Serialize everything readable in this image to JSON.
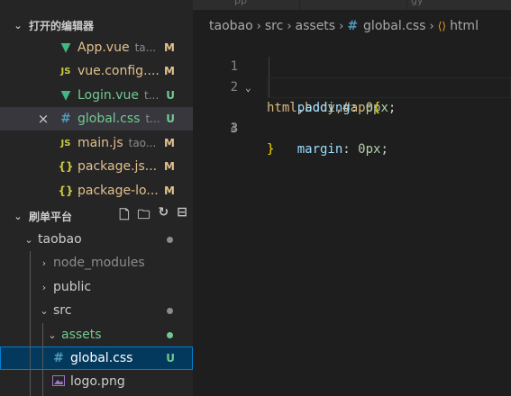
{
  "open_editors": {
    "title": "打开的编辑器",
    "items": [
      {
        "name": "App.vue",
        "desc": "ta...",
        "status": "M",
        "icon": "V",
        "selected": false
      },
      {
        "name": "vue.config....",
        "desc": "",
        "status": "M",
        "icon": "JS",
        "selected": false
      },
      {
        "name": "Login.vue",
        "desc": "t...",
        "status": "U",
        "icon": "V",
        "selected": false
      },
      {
        "name": "global.css",
        "desc": "t...",
        "status": "U",
        "icon": "#",
        "selected": true,
        "close": "×"
      },
      {
        "name": "main.js",
        "desc": "tao...",
        "status": "M",
        "icon": "JS",
        "selected": false
      },
      {
        "name": "package.js...",
        "desc": "",
        "status": "M",
        "icon": "{}",
        "selected": false
      },
      {
        "name": "package-lo...",
        "desc": "",
        "status": "M",
        "icon": "{}",
        "selected": false
      }
    ]
  },
  "explorer": {
    "title": "刷单平台",
    "tree": [
      {
        "name": "taobao",
        "chevron": "⌄",
        "dot": true
      },
      {
        "name": "node_modules",
        "chevron": "›",
        "dot": false
      },
      {
        "name": "public",
        "chevron": "›",
        "dot": false
      },
      {
        "name": "src",
        "chevron": "⌄",
        "dot": true
      },
      {
        "name": "assets",
        "chevron": "⌄",
        "dot": true
      },
      {
        "name": "global.css",
        "icon": "#",
        "status": "U"
      },
      {
        "name": "logo.png",
        "icon": "img"
      }
    ]
  },
  "tabs_fragments": [
    "pp",
    "gy"
  ],
  "breadcrumb": {
    "parts": [
      "taobao",
      "src",
      "assets",
      "global.css",
      "html"
    ],
    "css_icon": "#",
    "symbol_icon": "⟨⟩"
  },
  "code": {
    "lines": [
      {
        "num": "1",
        "fold": "⌄"
      },
      {
        "num": "2"
      },
      {
        "num": "3"
      },
      {
        "num": "4"
      }
    ],
    "tokens": {
      "selector": "html,body,#app",
      "open_brace": "{",
      "prop1": "padding",
      "val1": "0px",
      "prop2": "margin",
      "val2": "0px",
      "colon": ":",
      "semi": ";",
      "close_brace": "}",
      "indent": "    "
    }
  },
  "colors": {
    "modified": "#e2c08d",
    "untracked": "#73c991",
    "vue": "#41b883",
    "css": "#519aba",
    "js": "#cbcb41"
  }
}
